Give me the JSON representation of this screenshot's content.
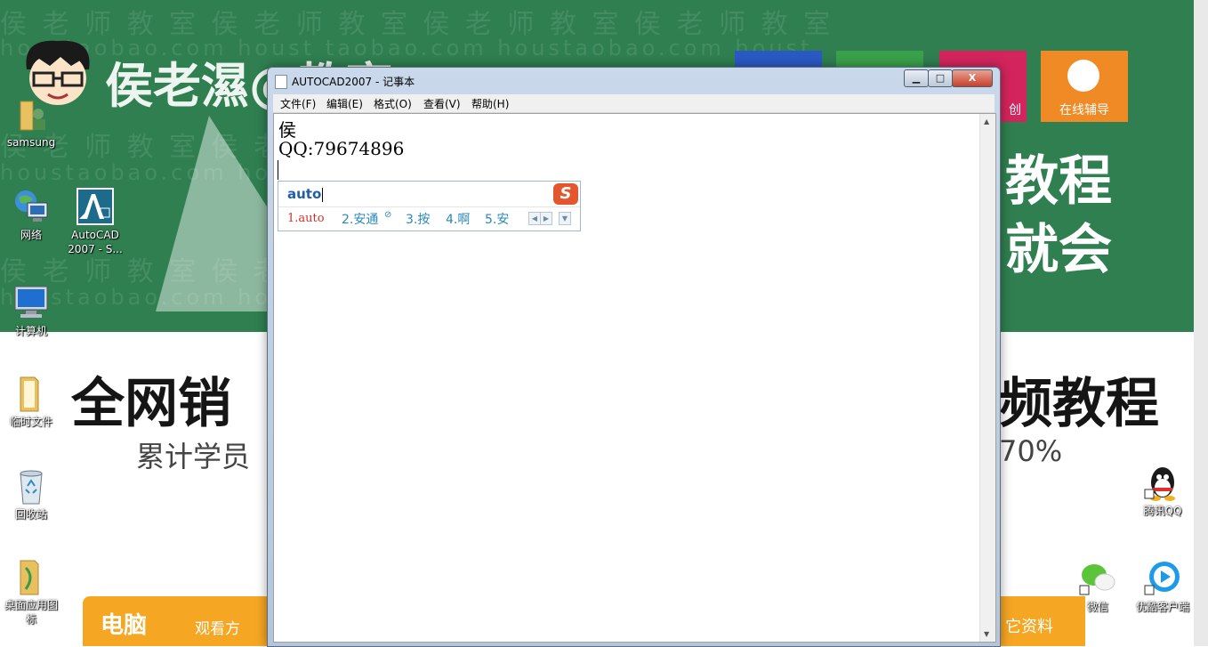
{
  "wallpaper": {
    "watermark_text": "侯 老 师 教 室     侯 老 师 教 室     侯 老 师 教 室     侯 老 师 教 室",
    "watermark_url": "houstaobao.com     houst taobao.com     houstaobao.com     houst",
    "brand_title": "侯老濕@教室",
    "brand_mark": "®",
    "tile_labels": [
      "",
      "",
      "创",
      "在线辅导"
    ],
    "right_text_1": "教程",
    "right_text_2": "就会",
    "headline_left": "全网销",
    "headline_right": "频教程",
    "subline_left": "累计学员",
    "subline_right": "70%",
    "banner_left_title": "电脑",
    "banner_left_sub": "观看方",
    "banner_right": "它资料",
    "colors": {
      "green": "#2f7f50",
      "orange": "#f5a623"
    }
  },
  "desktop_icons": [
    {
      "label": "samsung",
      "icon": "user-folder-icon"
    },
    {
      "label": "网络",
      "icon": "network-icon"
    },
    {
      "label": "AutoCAD 2007 - S...",
      "icon": "autocad-icon"
    },
    {
      "label": "计算机",
      "icon": "computer-icon"
    },
    {
      "label": "临时文件",
      "icon": "folder-icon"
    },
    {
      "label": "回收站",
      "icon": "recycle-bin-icon"
    },
    {
      "label": "桌面应用图标",
      "icon": "folder-icon"
    },
    {
      "label": "腾讯QQ",
      "icon": "qq-icon"
    },
    {
      "label": "微信",
      "icon": "wechat-icon"
    },
    {
      "label": "优酷客户端",
      "icon": "youku-icon"
    }
  ],
  "notepad": {
    "title": "AUTOCAD2007 - 记事本",
    "menu": [
      "文件(F)",
      "编辑(E)",
      "格式(O)",
      "查看(V)",
      "帮助(H)"
    ],
    "lines": [
      "侯",
      "QQ:79674896"
    ],
    "buttons": {
      "minimize": "▁",
      "maximize": "□",
      "close": "X"
    }
  },
  "ime": {
    "composition": "auto",
    "logo": "S",
    "candidates": [
      "1.auto",
      "2.安通",
      "3.按",
      "4.啊",
      "5.安"
    ],
    "candidate2_badge": "⊘",
    "nav": [
      "◀",
      "▶",
      "▼"
    ]
  }
}
